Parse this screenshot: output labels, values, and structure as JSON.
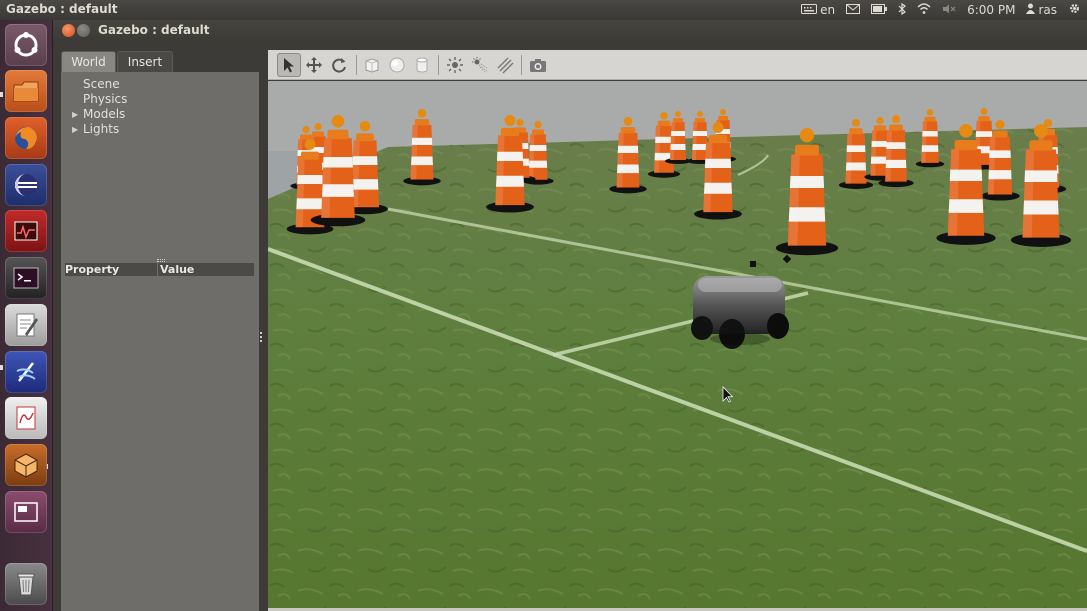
{
  "topbar": {
    "app_title": "Gazebo : default",
    "keyboard_lang": "en",
    "time": "6:00 PM",
    "user": "ras",
    "icons": [
      "keyboard-icon",
      "mail-icon",
      "battery-icon",
      "bluetooth-icon",
      "wifi-icon",
      "volume-muted-icon",
      "user-icon",
      "power-gear-icon"
    ]
  },
  "launcher": {
    "items": [
      "ubuntu-dash",
      "files",
      "firefox",
      "eclipse",
      "system-monitor",
      "terminal",
      "text-editor",
      "synaptic",
      "pdf-viewer",
      "virtualbox",
      "workspace-switcher",
      "trash"
    ]
  },
  "window": {
    "title": "Gazebo : default"
  },
  "left_panel": {
    "tabs": [
      "World",
      "Insert"
    ],
    "active_tab": "World",
    "tree": [
      {
        "label": "Scene",
        "expandable": false
      },
      {
        "label": "Physics",
        "expandable": false
      },
      {
        "label": "Models",
        "expandable": true
      },
      {
        "label": "Lights",
        "expandable": true
      }
    ],
    "property_header": {
      "col1": "Property",
      "col2": "Value"
    }
  },
  "toolbar": {
    "tools": [
      "select-tool",
      "translate-tool",
      "rotate-tool",
      "box-shape",
      "sphere-shape",
      "cylinder-shape",
      "point-light",
      "spot-light",
      "directional-light",
      "screenshot"
    ],
    "active_tool": "select-tool"
  },
  "colors": {
    "cone_orange": "#e4611a",
    "grass": "#6b8a45",
    "sky": "#9ea3a6",
    "close_button": "#e05a2b"
  }
}
